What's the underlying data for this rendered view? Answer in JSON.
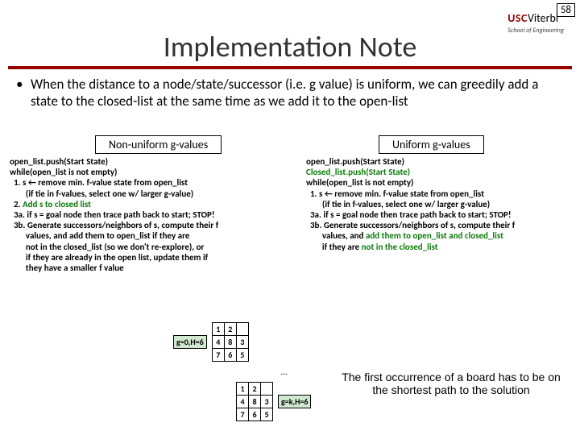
{
  "page_number": "58",
  "logo": {
    "usc": "USC",
    "vit": "Viterbi",
    "sub": "School of Engineering"
  },
  "title": "Implementation Note",
  "bullet": "When the distance to a node/state/successor (i.e. g value) is uniform, we can greedily add a state to the closed-list at the same time as we add it to the open-list",
  "headings": {
    "left": "Non-uniform g-values",
    "right": "Uniform g-values"
  },
  "algo_left": {
    "l1": "open_list.push(Start State)",
    "l2": "while(open_list is not empty)",
    "l3": "  1. s ← remove min. f-value state from open_list",
    "l4": "        (if tie in f-values, select one w/ larger g-value)",
    "l5a": "  2. ",
    "l5b": "Add s to closed list",
    "l6": "  3a. if s = goal node then trace path back to start; STOP!",
    "l7": "  3b. Generate successors/neighbors of s, compute their f",
    "l8": "        values, and add them to open_list if they are",
    "l9": "        not in the closed_list (so we don't re-explore), or",
    "l10": "        if they are already in the open list, update them if",
    "l11": "        they have a smaller f value"
  },
  "algo_right": {
    "l1": "open_list.push(Start State)",
    "l2": "Closed_list.push(Start State)",
    "l3": "while(open_list is not empty)",
    "l4": "  1. s ← remove min. f-value state from open_list",
    "l5": "        (if tie in f-values, select one w/ larger g-value)",
    "l6": "  3a. if s = goal node then trace path back to start; STOP!",
    "l7": "  3b. Generate successors/neighbors of s, compute their f",
    "l8a": "        values, and ",
    "l8b": "add them to open_list and closed_list",
    "l9a": "        if they are ",
    "l9b": "not in the closed_list"
  },
  "diagram": {
    "tag1": "g=0,H=6",
    "tag2": "g=k,H=6",
    "dots": "…",
    "board1": [
      "1",
      "2",
      "",
      "4",
      "8",
      "3",
      "7",
      "6",
      "5"
    ],
    "board2": [
      "1",
      "2",
      "",
      "4",
      "8",
      "3",
      "7",
      "6",
      "5"
    ]
  },
  "note": "The first occurrence of a board has to be on the shortest path to the solution"
}
